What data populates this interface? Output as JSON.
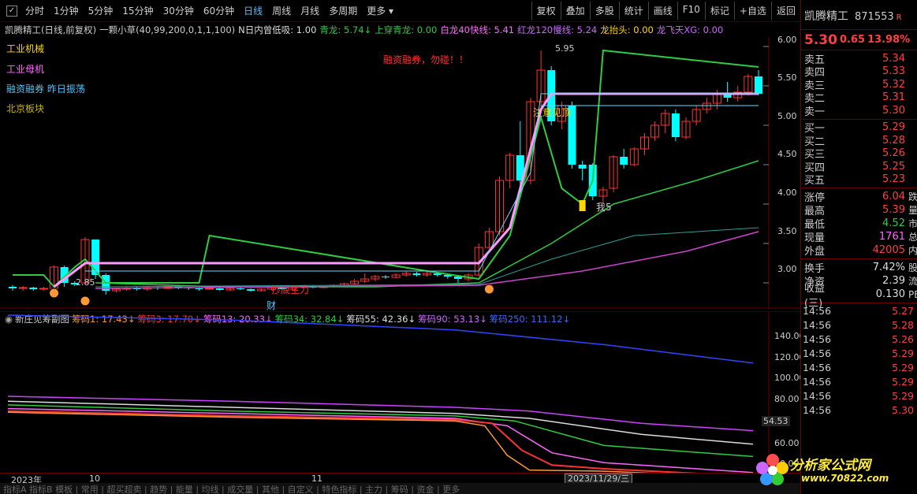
{
  "toolbar": {
    "check": "✓",
    "periods": [
      "分时",
      "1分钟",
      "5分钟",
      "15分钟",
      "30分钟",
      "60分钟",
      "日线",
      "周线",
      "月线",
      "多周期",
      "更多 ▾"
    ],
    "active_period": "日线",
    "actions": [
      "复权",
      "叠加",
      "多股",
      "统计",
      "画线",
      "F10",
      "标记",
      "+自选",
      "返回"
    ]
  },
  "indicator": {
    "stock": "凯腾精工(日线,前复权)",
    "formula": "一颗小草(40,99,200,0,1,1,100)",
    "ndaylow": "N日内曾低吸: 1.00",
    "qinglong": "青龙: 5.74↓",
    "shangchuan": "上穿青龙: 0.00",
    "bailong": "白龙40快线: 5.41",
    "honglong": "红龙120慢线: 5.24",
    "longtaitou": "龙抬头: 0.00",
    "longfeitian": "龙飞天XG: 0.00",
    "colors": {
      "qinglong": "#2ecc40",
      "bailong": "#ff66ff",
      "honglong": "#cc66ff",
      "longtaitou": "#ffd700",
      "longfeitian": "#cc66ff"
    }
  },
  "side_labels": {
    "l1": "工业机械",
    "l2": "工业母机",
    "l3": "融资融券 昨日振荡",
    "l4": "北京板块"
  },
  "annotations": {
    "margin_note": "融资融券，勿碰！！",
    "high_mark": "5.95",
    "low_mark": "2.85",
    "attention": "注意见顶",
    "buy": "我5",
    "bottom": "抄底主力",
    "cai": "财"
  },
  "price_axis": [
    "6.00",
    "5.50",
    "5.00",
    "4.50",
    "4.00",
    "3.50",
    "3.00"
  ],
  "sub_indicator": {
    "name": "新庄见筹副图",
    "items": [
      {
        "label": "筹码1: 17.43↓",
        "color": "#ff9933"
      },
      {
        "label": "筹码3: 17.70↓",
        "color": "#ff3333"
      },
      {
        "label": "筹码13: 20.33↓",
        "color": "#ff66ff"
      },
      {
        "label": "筹码34: 32.84↓",
        "color": "#2ecc40"
      },
      {
        "label": "筹码55: 42.36↓",
        "color": "#dddddd"
      },
      {
        "label": "筹码90: 53.13↓",
        "color": "#cc66ff"
      },
      {
        "label": "筹码250: 111.12↓",
        "color": "#4466ff"
      }
    ],
    "axis": [
      "140.00",
      "120.00",
      "100.00",
      "80.00",
      "60.00",
      "40.00"
    ],
    "current": "54.53"
  },
  "date_axis": {
    "year": "2023年",
    "m10": "10",
    "m11": "11",
    "cursor": "2023/11/29/三"
  },
  "bottom_strip": "指标A 指标B 模板 | 常用 | 超买超卖 | 趋势 | 能量 | 均线 | 成交量 | 其他 | 自定义 | 特色指标 | 主力 | 筹码 | 资金 | 更多",
  "quote": {
    "name": "凯腾精工",
    "code": "871553",
    "r": "R",
    "price": "5.30",
    "change": "0.65",
    "pct": "13.98%",
    "sells": [
      {
        "label": "卖五",
        "value": "5.34"
      },
      {
        "label": "卖四",
        "value": "5.33"
      },
      {
        "label": "卖三",
        "value": "5.32"
      },
      {
        "label": "卖二",
        "value": "5.31"
      },
      {
        "label": "卖一",
        "value": "5.30"
      }
    ],
    "buys": [
      {
        "label": "买一",
        "value": "5.29"
      },
      {
        "label": "买二",
        "value": "5.28"
      },
      {
        "label": "买三",
        "value": "5.26"
      },
      {
        "label": "买四",
        "value": "5.25"
      },
      {
        "label": "买五",
        "value": "5.23"
      }
    ],
    "stats1": [
      {
        "label": "涨停",
        "value": "6.04",
        "tail": "跌",
        "color": "#ff4040"
      },
      {
        "label": "最高",
        "value": "5.39",
        "tail": "量",
        "color": "#ff4040"
      },
      {
        "label": "最低",
        "value": "4.52",
        "tail": "市",
        "color": "#2ecc40"
      },
      {
        "label": "现量",
        "value": "1761",
        "tail": "总",
        "color": "#ff66ff"
      },
      {
        "label": "外盘",
        "value": "42005",
        "tail": "内",
        "color": "#ff4040"
      }
    ],
    "stats2": [
      {
        "label": "换手",
        "value": "7.42%",
        "tail": "股",
        "color": "#dddddd"
      },
      {
        "label": "净资",
        "value": "2.39",
        "tail": "流",
        "color": "#dddddd"
      },
      {
        "label": "收益(三)",
        "value": "0.130",
        "tail": "PE",
        "color": "#dddddd"
      }
    ],
    "ticks": [
      {
        "time": "14:56",
        "value": "5.27"
      },
      {
        "time": "14:56",
        "value": "5.28"
      },
      {
        "time": "14:56",
        "value": "5.26"
      },
      {
        "time": "14:56",
        "value": "5.29"
      },
      {
        "time": "14:56",
        "value": "5.29"
      },
      {
        "time": "14:56",
        "value": "5.29"
      },
      {
        "time": "14:56",
        "value": "5.29"
      },
      {
        "time": "14:56",
        "value": "5.30"
      }
    ]
  },
  "logo": {
    "t1": "分析家公式网",
    "t2": "www.70822.com"
  }
}
